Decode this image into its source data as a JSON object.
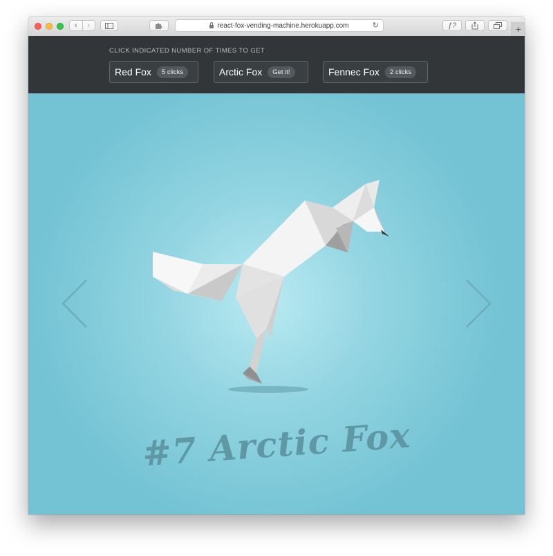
{
  "browser": {
    "url": "react-fox-vending-machine.herokuapp.com",
    "back_icon": "‹",
    "forward_icon": "›",
    "reader_icon": "ƒ?",
    "newtab_icon": "+"
  },
  "header": {
    "caption": "CLICK INDICATED NUMBER OF TIMES TO GET",
    "buttons": [
      {
        "label": "Red Fox",
        "badge": "5 clicks"
      },
      {
        "label": "Arctic Fox",
        "badge": "Get it!"
      },
      {
        "label": "Fennec Fox",
        "badge": "2 clicks"
      }
    ]
  },
  "stage": {
    "title": "#7 Arctic Fox",
    "background_color": "#73c3d4",
    "title_color": "#5f98a4"
  },
  "icons": {
    "prev": "chevron-left-icon",
    "next": "chevron-right-icon",
    "fox": "origami-fox-illustration"
  }
}
